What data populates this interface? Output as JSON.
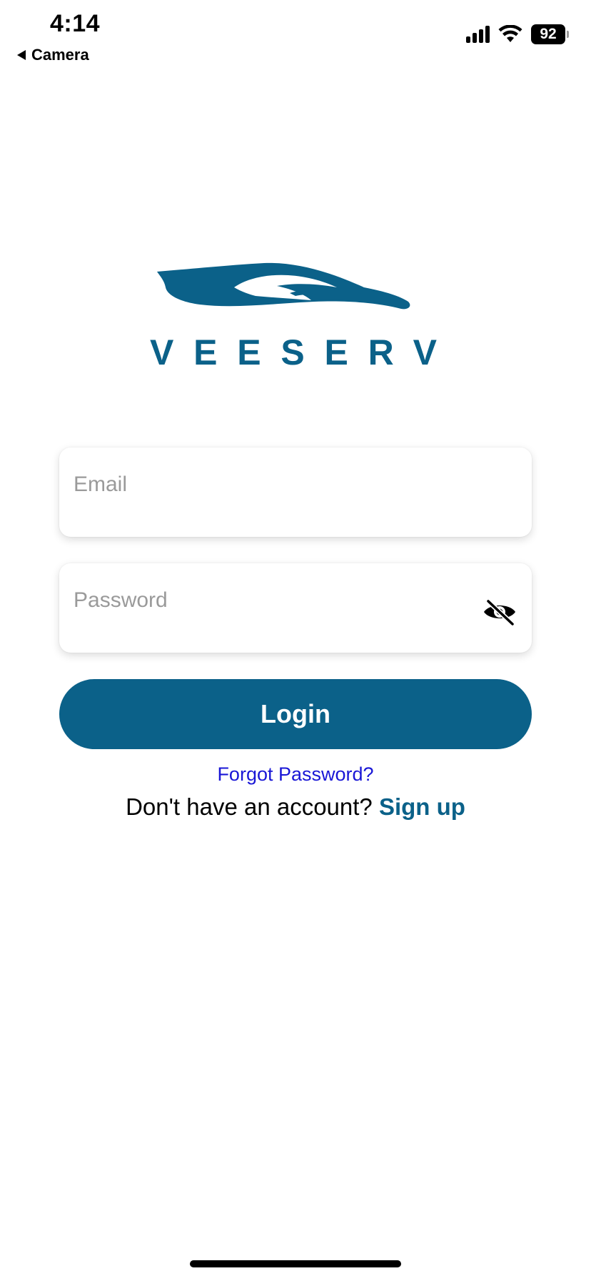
{
  "status_bar": {
    "time": "4:14",
    "back_app": "Camera",
    "battery": "92"
  },
  "logo": {
    "text": "VEESERV",
    "color": "#0b6189"
  },
  "form": {
    "email_placeholder": "Email",
    "password_placeholder": "Password",
    "password_toggle_icon": "eye-off-icon",
    "login_label": "Login",
    "forgot_label": "Forgot Password?",
    "signup_prompt": "Don't have an account? ",
    "signup_label": "Sign up"
  },
  "colors": {
    "brand": "#0b6189",
    "link": "#1a17d6"
  }
}
